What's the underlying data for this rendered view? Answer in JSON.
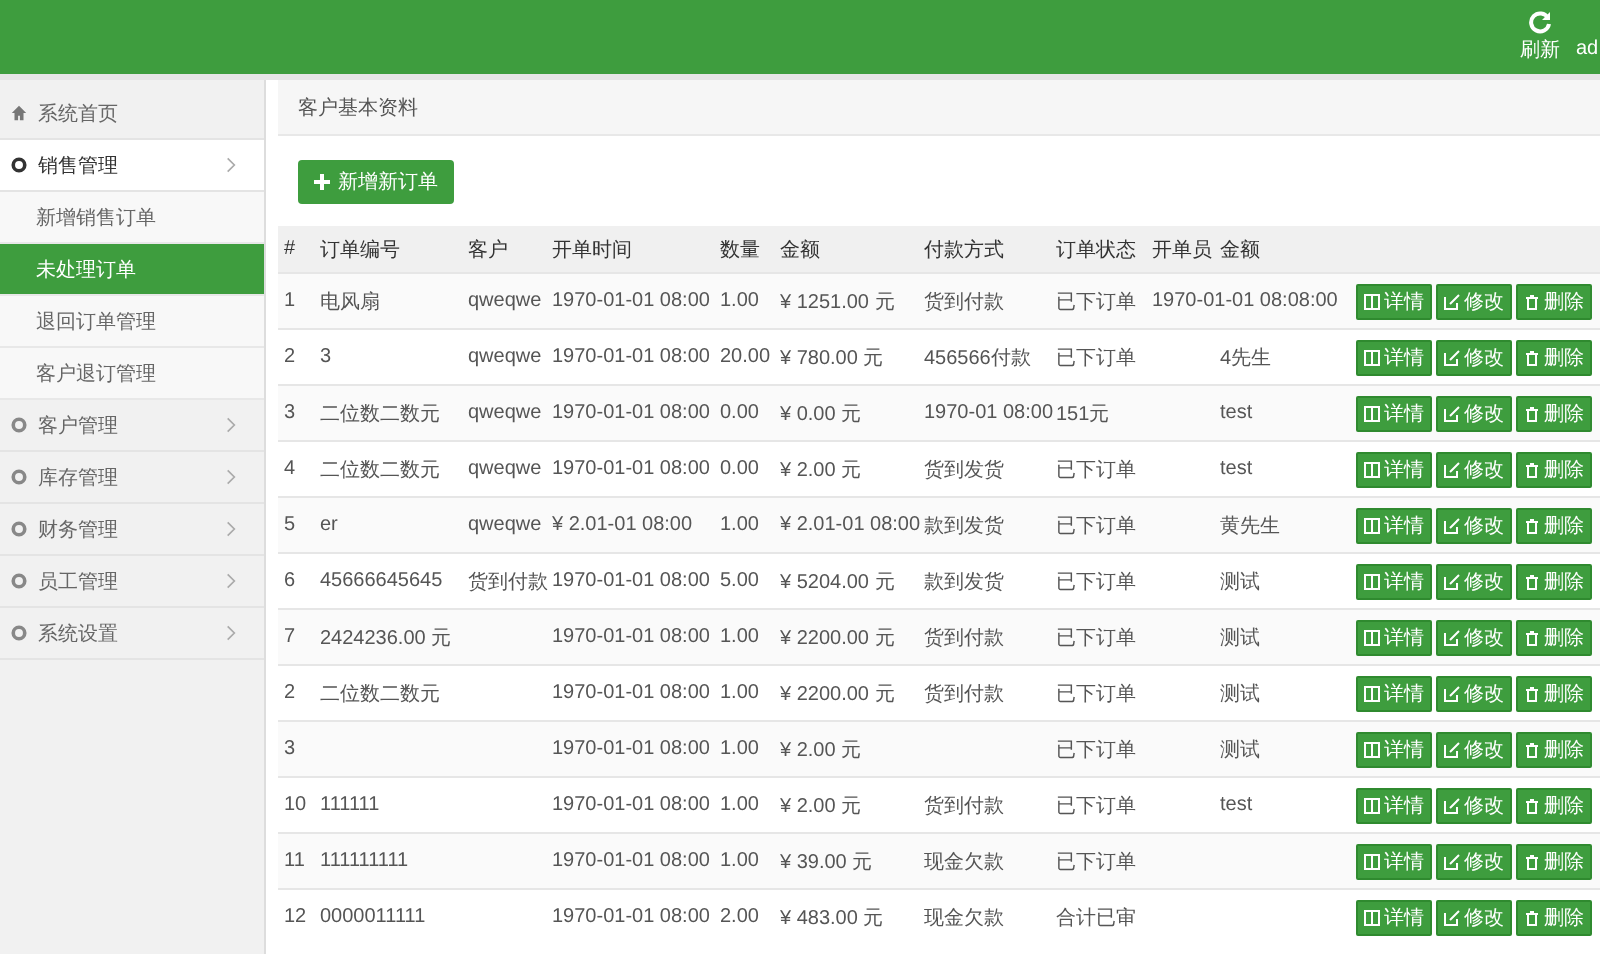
{
  "topbar": {
    "refresh": "刷新",
    "user": "ad"
  },
  "sidebar": {
    "home": "系统首页",
    "items": [
      {
        "label": "销售管理",
        "expanded": true,
        "children": [
          {
            "label": "新增销售订单",
            "selected": false
          },
          {
            "label": "未处理订单",
            "selected": true
          },
          {
            "label": "退回订单管理",
            "selected": false
          },
          {
            "label": "客户退订管理",
            "selected": false
          }
        ]
      },
      {
        "label": "客户管理",
        "expanded": false
      },
      {
        "label": "库存管理",
        "expanded": false
      },
      {
        "label": "财务管理",
        "expanded": false
      },
      {
        "label": "员工管理",
        "expanded": false
      },
      {
        "label": "系统设置",
        "expanded": false
      }
    ]
  },
  "breadcrumb": "客户基本资料",
  "add_button": "新增新订单",
  "table": {
    "columns": [
      "#",
      "订单编号",
      "客户",
      "开单时间",
      "数量",
      "金额",
      "付款方式",
      "订单状态",
      "开单员",
      "金额"
    ],
    "rows": [
      {
        "cells": [
          "1",
          "电风扇",
          "qweqwe",
          "1970-01-01 08:00",
          "1.00",
          "¥ 1251.00 元",
          "货到付款",
          "已下订单",
          "1970-01-01 08:08:00",
          ""
        ],
        "actions": [
          "详情",
          "修改",
          "删除"
        ]
      },
      {
        "cells": [
          "2",
          "3",
          "qweqwe",
          "1970-01-01 08:00",
          "20.00",
          "¥ 780.00 元",
          "456566付款",
          "已下订单",
          "",
          "4先生"
        ],
        "actions": [
          "详情",
          "修改",
          "删除"
        ]
      },
      {
        "cells": [
          "3",
          "二位数二数元",
          "qweqwe",
          "1970-01-01 08:00",
          "0.00",
          "¥ 0.00 元",
          "1970-01 08:00",
          "151元",
          "",
          "test"
        ],
        "actions": [
          "详情",
          "修改",
          "删除"
        ]
      },
      {
        "cells": [
          "4",
          "二位数二数元",
          "qweqwe",
          "1970-01-01 08:00",
          "0.00",
          "¥ 2.00 元",
          "货到发货",
          "已下订单",
          "",
          "test"
        ],
        "actions": [
          "详情",
          "修改",
          "删除"
        ]
      },
      {
        "cells": [
          "5",
          "er",
          "qweqwe",
          "¥ 2.01-01 08:00",
          "1.00",
          "¥ 2.01-01 08:00",
          "款到发货",
          "已下订单",
          "",
          "黄先生"
        ],
        "actions": [
          "详情",
          "修改",
          "删除"
        ]
      },
      {
        "cells": [
          "6",
          "45666645645",
          "货到付款",
          "1970-01-01 08:00",
          "5.00",
          "¥ 5204.00 元",
          "款到发货",
          "已下订单",
          "",
          "测试"
        ],
        "actions": [
          "详情",
          "修改",
          "删除"
        ]
      },
      {
        "cells": [
          "7",
          "2424236.00 元",
          "",
          "1970-01-01 08:00",
          "1.00",
          "¥ 2200.00 元",
          "货到付款",
          "已下订单",
          "",
          "测试"
        ],
        "actions": [
          "详情",
          "修改",
          "删除"
        ]
      },
      {
        "cells": [
          "2",
          "二位数二数元",
          "",
          "1970-01-01 08:00",
          "1.00",
          "¥ 2200.00 元",
          "货到付款",
          "已下订单",
          "",
          "测试"
        ],
        "actions": [
          "详情",
          "修改",
          "删除"
        ]
      },
      {
        "cells": [
          "3",
          "",
          "",
          "1970-01-01 08:00",
          "1.00",
          "¥ 2.00 元",
          "",
          "已下订单",
          "",
          "测试"
        ],
        "actions": [
          "详情",
          "修改",
          "删除"
        ]
      },
      {
        "cells": [
          "10",
          "111111",
          "",
          "1970-01-01 08:00",
          "1.00",
          "¥ 2.00 元",
          "货到付款",
          "已下订单",
          "",
          "test"
        ],
        "actions": [
          "详情",
          "修改",
          "删除"
        ]
      },
      {
        "cells": [
          "11",
          "111111111",
          "",
          "1970-01-01 08:00",
          "1.00",
          "¥ 39.00 元",
          "现金欠款",
          "已下订单",
          "",
          ""
        ],
        "actions": [
          "详情",
          "修改",
          "删除"
        ]
      },
      {
        "cells": [
          "12",
          "0000011111",
          "",
          "1970-01-01 08:00",
          "2.00",
          "¥ 483.00 元",
          "现金欠款",
          "合计已审",
          "",
          ""
        ],
        "actions": [
          "详情",
          "修改",
          "删除"
        ]
      }
    ]
  }
}
